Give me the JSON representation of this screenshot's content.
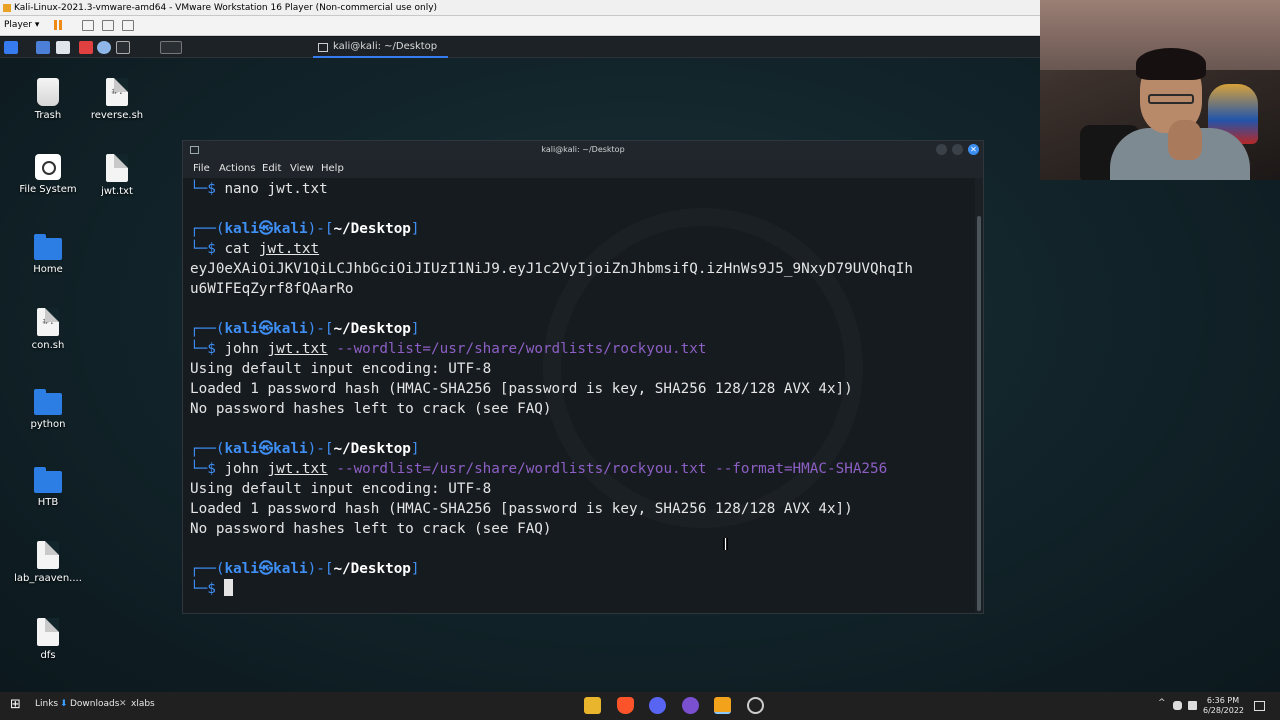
{
  "vmware": {
    "window_title": "Kali-Linux-2021.3-vmware-amd64 - VMware Workstation 16 Player (Non-commercial use only)",
    "player_menu": "Player"
  },
  "kali_panel": {
    "task_title": "kali@kali: ~/Desktop"
  },
  "desktop_icons": [
    {
      "label": "Trash",
      "icon": "trash-icon"
    },
    {
      "label": "reverse.sh",
      "icon": "script-file-icon"
    },
    {
      "label": "File System",
      "icon": "drive-icon"
    },
    {
      "label": "jwt.txt",
      "icon": "text-file-icon"
    },
    {
      "label": "Home",
      "icon": "home-folder-icon"
    },
    {
      "label": "con.sh",
      "icon": "script-file-icon"
    },
    {
      "label": "python",
      "icon": "folder-icon"
    },
    {
      "label": "HTB",
      "icon": "folder-icon"
    },
    {
      "label": "lab_raaven....",
      "icon": "file-icon"
    },
    {
      "label": "dfs",
      "icon": "file-icon"
    }
  ],
  "terminal": {
    "title": "kali@kali: ~/Desktop",
    "menu": [
      "File",
      "Actions",
      "Edit",
      "View",
      "Help"
    ],
    "prompt_user": "kali",
    "prompt_host": "kali",
    "prompt_dir": "~/Desktop",
    "lines": {
      "l1_cmd": "nano",
      "l1_arg": "jwt.txt",
      "l3_cmd": "cat",
      "l3_arg": "jwt.txt",
      "l4": "eyJ0eXAiOiJKV1QiLCJhbGciOiJIUzI1NiJ9.eyJ1c2VyIjoiZnJhbmsifQ.izHnWs9J5_9NxyD79UVQhqIh",
      "l5": "u6WIFEqZyrf8fQAarRo",
      "l7_cmd": "john",
      "l7_arg": "jwt.txt",
      "l7_opt": "--wordlist=/usr/share/wordlists/rockyou.txt",
      "l8": "Using default input encoding: UTF-8",
      "l9": "Loaded 1 password hash (HMAC-SHA256 [password is key, SHA256 128/128 AVX 4x])",
      "l10": "No password hashes left to crack (see FAQ)",
      "l13_cmd": "john",
      "l13_arg": "jwt.txt",
      "l13_opt": "--wordlist=/usr/share/wordlists/rockyou.txt",
      "l13_opt2": "--format=HMAC-SHA256",
      "l14": "Using default input encoding: UTF-8",
      "l15": "Loaded 1 password hash (HMAC-SHA256 [password is key, SHA256 128/128 AVX 4x])",
      "l16": "No password hashes left to crack (see FAQ)"
    }
  },
  "taskbar": {
    "links_label": "Links",
    "downloads_label": "Downloads",
    "xlabs_label": "xlabs",
    "time": "6:36 PM",
    "date": "6/28/2022"
  },
  "colors": {
    "prompt_blue": "#3f8ff5",
    "option_purple": "#8c5fc4",
    "terminal_bg": "#161b1f",
    "accent_close": "#3b8ef0"
  }
}
